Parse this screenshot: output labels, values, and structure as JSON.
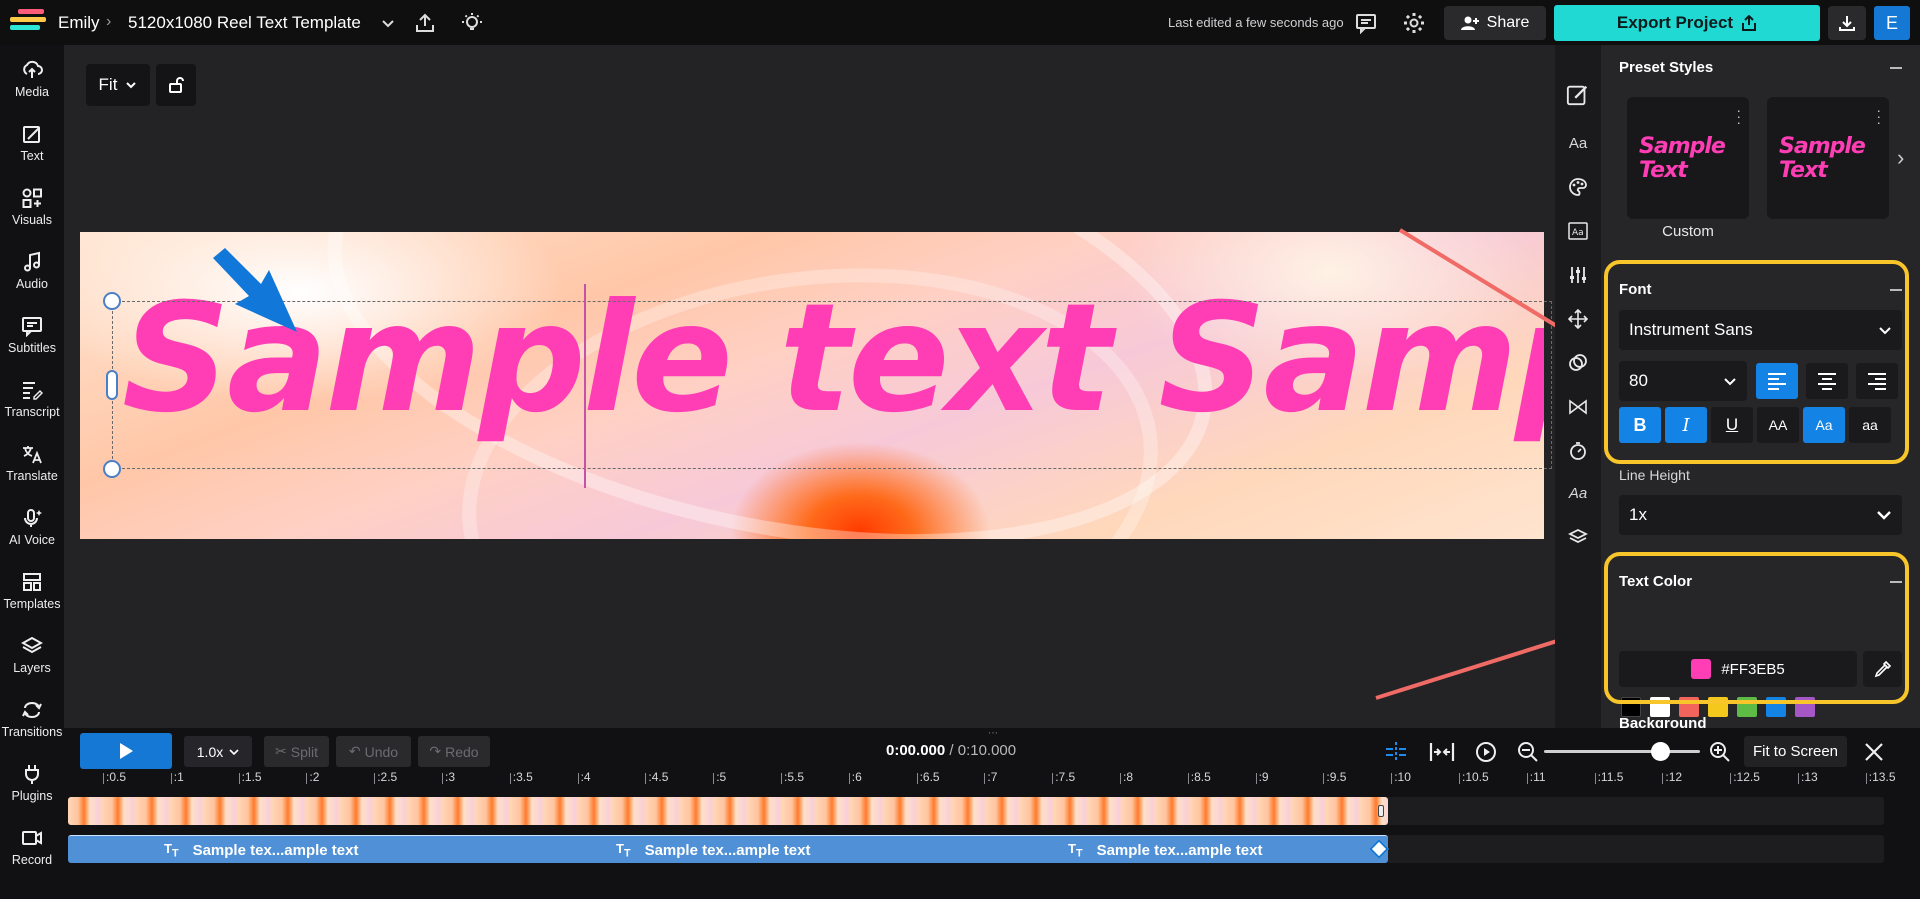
{
  "header": {
    "user": "Emily",
    "project_title": "5120x1080 Reel Text Template",
    "last_edited": "Last edited a few seconds ago",
    "share_label": "Share",
    "export_label": "Export Project",
    "avatar_letter": "E"
  },
  "sidebar": {
    "items": [
      {
        "label": "Media",
        "icon": "media-upload-icon"
      },
      {
        "label": "Text",
        "icon": "text-edit-icon"
      },
      {
        "label": "Visuals",
        "icon": "visuals-icon"
      },
      {
        "label": "Audio",
        "icon": "music-note-icon"
      },
      {
        "label": "Subtitles",
        "icon": "subtitles-icon"
      },
      {
        "label": "Transcript",
        "icon": "transcript-icon"
      },
      {
        "label": "Translate",
        "icon": "translate-icon"
      },
      {
        "label": "AI Voice",
        "icon": "ai-voice-icon"
      },
      {
        "label": "Templates",
        "icon": "templates-icon"
      },
      {
        "label": "Layers",
        "icon": "layers-icon"
      },
      {
        "label": "Transitions",
        "icon": "transitions-icon"
      },
      {
        "label": "Plugins",
        "icon": "plugin-icon"
      },
      {
        "label": "Record",
        "icon": "record-icon"
      }
    ]
  },
  "canvas": {
    "fit_label": "Fit",
    "sample_text": "Sample text Sample text",
    "text_color": "#FF3EB5"
  },
  "panel": {
    "preset_styles_title": "Preset Styles",
    "preset_text": "Sample Text",
    "preset_custom_label": "Custom",
    "font_title": "Font",
    "font_family": "Instrument Sans",
    "font_size": "80",
    "format_buttons": {
      "bold": "B",
      "italic": "I",
      "underline": "U",
      "upper": "AA",
      "title": "Aa",
      "lower": "aa"
    },
    "line_height_title": "Line Height",
    "line_height_value": "1x",
    "text_color_title": "Text Color",
    "text_color_hex": "#FF3EB5",
    "swatches": [
      "#000000",
      "#FFFFFF",
      "#F2645C",
      "#F5C81E",
      "#5DBB46",
      "#1483E6",
      "#A457C5"
    ],
    "background_title": "Background"
  },
  "timeline": {
    "speed": "1.0x",
    "split_label": "Split",
    "undo_label": "Undo",
    "redo_label": "Redo",
    "current_time": "0:00.000",
    "duration": "/ 0:10.000",
    "fit_to_screen_label": "Fit to Screen",
    "ruler_ticks": [
      ":0.5",
      ":1",
      ":1.5",
      ":2",
      ":2.5",
      ":3",
      ":3.5",
      ":4",
      ":4.5",
      ":5",
      ":5.5",
      ":6",
      ":6.5",
      ":7",
      ":7.5",
      ":8",
      ":8.5",
      ":9",
      ":9.5",
      ":10",
      ":10.5",
      ":11",
      ":11.5",
      ":12",
      ":12.5",
      ":13",
      ":13.5"
    ],
    "text_clips": [
      "Sample tex...ample text",
      "Sample tex...ample text",
      "Sample tex...ample text"
    ]
  },
  "colors": {
    "accent": "#1478D4",
    "export": "#1FD9D2",
    "highlight": "#F8C52A",
    "annotation_arrow": "#F06A66"
  }
}
